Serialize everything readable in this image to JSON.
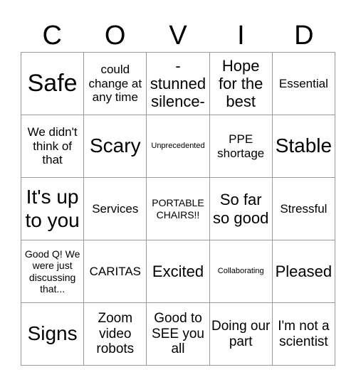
{
  "title_letters": [
    "C",
    "O",
    "V",
    "I",
    "D"
  ],
  "cells": [
    [
      "Safe",
      "could change at any time",
      "- stunned silence-",
      "Hope for the best",
      "Essential"
    ],
    [
      "We didn't think of that",
      "Scary",
      "Unprecedented",
      "PPE shortage",
      "Stable"
    ],
    [
      "It's up to you",
      "Services",
      "PORTABLE CHAIRS!!",
      "So far so good",
      "Stressful"
    ],
    [
      "Good Q! We were just discussing that...",
      "CARITAS",
      "Excited",
      "Collaborating",
      "Pleased"
    ],
    [
      "Signs",
      "Zoom video robots",
      "Good to SEE you all",
      "Doing our part",
      "I'm not a scientist"
    ]
  ]
}
